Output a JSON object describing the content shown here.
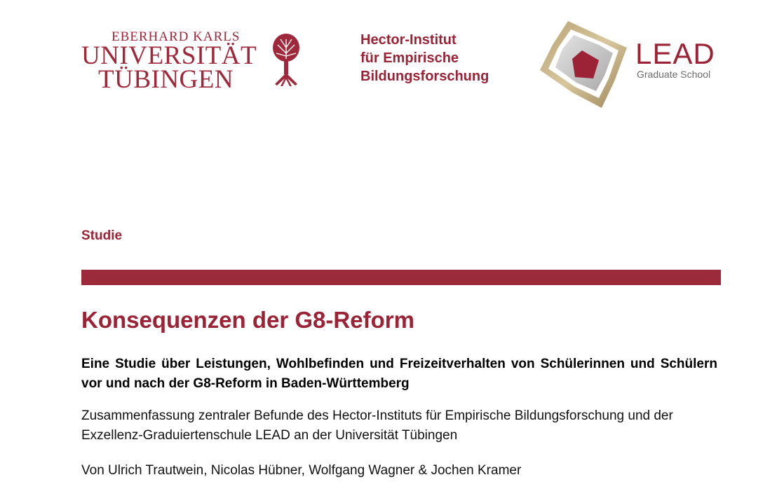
{
  "header": {
    "university": {
      "line1": "EBERHARD KARLS",
      "line2": "UNIVERSITÄT",
      "line3": "TÜBINGEN",
      "tree_icon": "tree-icon",
      "color": "#a0283b"
    },
    "institute": {
      "line1": "Hector-Institut",
      "line2": "für Empirische",
      "line3": "Bildungsforschung",
      "color": "#9b2335"
    },
    "lead": {
      "word": "LEAD",
      "subtitle": "Graduate School",
      "star_icon": "star-emblem-icon"
    }
  },
  "document": {
    "kicker": "Studie",
    "rule_color": "#9b2a3a",
    "title": "Konsequenzen der G8-Reform",
    "subtitle": "Eine Studie über Leistungen, Wohlbefinden und Freizeitverhalten von Schülerinnen und Schülern vor und nach der G8-Reform in Baden-Württemberg",
    "summary": "Zusammenfassung zentraler Befunde des Hector-Instituts für Empirische Bildungsforschung und der Exzellenz-Graduiertenschule LEAD an der Universität Tübingen",
    "authors": "Von Ulrich Trautwein, Nicolas Hübner, Wolfgang Wagner & Jochen Kramer"
  }
}
